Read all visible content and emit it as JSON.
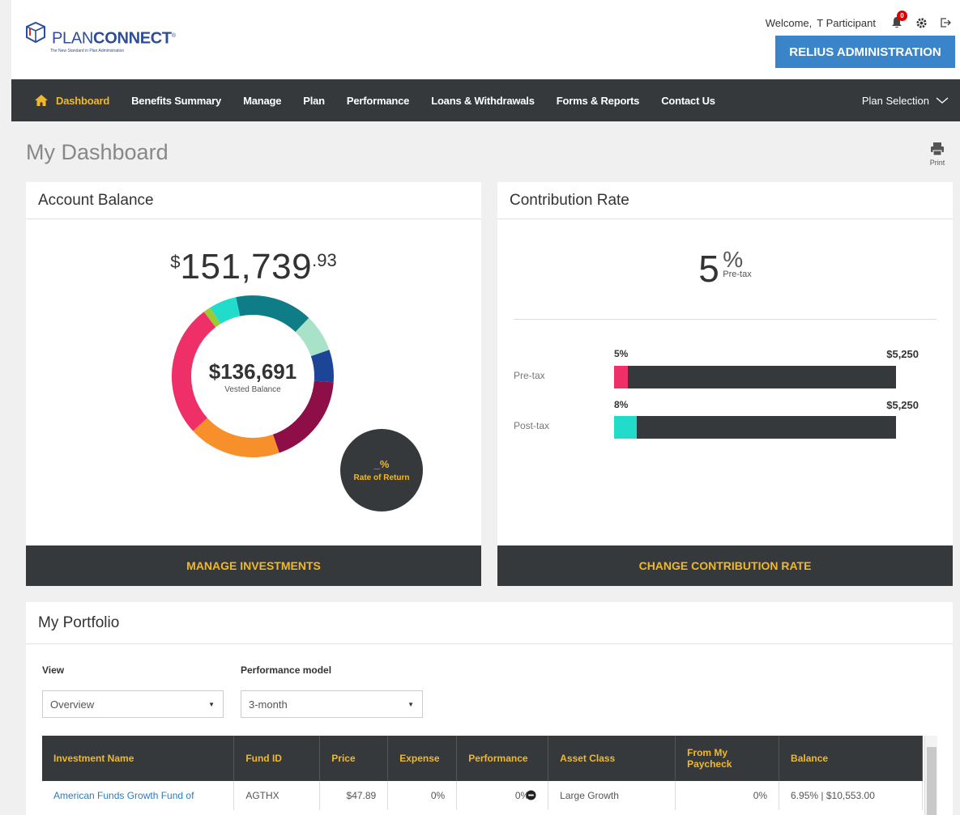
{
  "header": {
    "logo_text_1": "PLAN",
    "logo_text_2": "CONNECT",
    "logo_tagline": "The New Standard in Plan Administration",
    "welcome": "Welcome,",
    "user_name": "T Participant",
    "notification_count": "0",
    "relius_button": "RELIUS ADMINISTRATION"
  },
  "nav": {
    "items": [
      "Dashboard",
      "Benefits Summary",
      "Manage",
      "Plan",
      "Performance",
      "Loans & Withdrawals",
      "Forms & Reports",
      "Contact Us"
    ],
    "plan_selection": "Plan Selection"
  },
  "page": {
    "title": "My Dashboard",
    "print_label": "Print"
  },
  "account_balance": {
    "title": "Account Balance",
    "currency": "$",
    "amount": "151,739",
    "cents": ".93",
    "vested_value": "$136,691",
    "vested_label": "Vested Balance",
    "ror_value": "_%",
    "ror_label": "Rate of Return",
    "button": "MANAGE INVESTMENTS",
    "donut_segments": [
      {
        "color": "#0e7d87",
        "fraction": 0.155
      },
      {
        "color": "#a7e2c9",
        "fraction": 0.075
      },
      {
        "color": "#1c4597",
        "fraction": 0.065
      },
      {
        "color": "#8e0e47",
        "fraction": 0.185
      },
      {
        "color": "#f7902a",
        "fraction": 0.185
      },
      {
        "color": "#ef2f68",
        "fraction": 0.265
      },
      {
        "color": "#9acb33",
        "fraction": 0.015
      },
      {
        "color": "#22dccb",
        "fraction": 0.055
      }
    ]
  },
  "contribution": {
    "title": "Contribution Rate",
    "rate_number": "5",
    "rate_symbol": "%",
    "rate_type": "Pre-tax",
    "rows": [
      {
        "label": "Pre-tax",
        "pct": "5%",
        "amount": "$5,250",
        "fill": 0.05,
        "color": "#ef2f68"
      },
      {
        "label": "Post-tax",
        "pct": "8%",
        "amount": "$5,250",
        "fill": 0.08,
        "color": "#22dccb"
      }
    ],
    "button": "CHANGE CONTRIBUTION RATE"
  },
  "portfolio": {
    "title": "My Portfolio",
    "view_label": "View",
    "view_value": "Overview",
    "perf_label": "Performance model",
    "perf_value": "3-month",
    "columns": [
      "Investment Name",
      "Fund ID",
      "Price",
      "Expense",
      "Performance",
      "Asset Class",
      "From My Paycheck",
      "Balance"
    ],
    "rows": [
      {
        "name": "American Funds Growth Fund of",
        "fund_id": "AGTHX",
        "price": "$47.89",
        "expense": "0%",
        "performance": "0%",
        "asset_class": "Large Growth",
        "paycheck": "0%",
        "balance": "6.95% | $10,553.00"
      }
    ]
  }
}
